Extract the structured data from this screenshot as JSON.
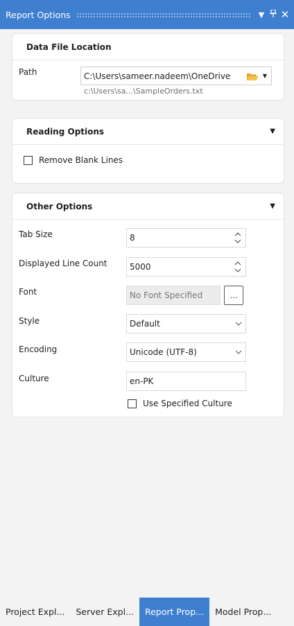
{
  "panel": {
    "title": "Report Options"
  },
  "data_file": {
    "header": "Data File Location",
    "path_label": "Path",
    "path_value": "C:\\Users\\sameer.nadeem\\OneDrive",
    "path_hint": "c:\\Users\\sa...\\SampleOrders.txt"
  },
  "reading": {
    "header": "Reading Options",
    "remove_blank_lines_label": "Remove Blank Lines",
    "remove_blank_lines_checked": false
  },
  "other": {
    "header": "Other Options",
    "tab_size_label": "Tab Size",
    "tab_size_value": "8",
    "line_count_label": "Displayed Line Count",
    "line_count_value": "5000",
    "font_label": "Font",
    "font_value": "No Font Specified",
    "font_button": "...",
    "style_label": "Style",
    "style_value": "Default",
    "encoding_label": "Encoding",
    "encoding_value": "Unicode (UTF-8)",
    "culture_label": "Culture",
    "culture_value": "en-PK",
    "use_specified_culture_label": "Use Specified Culture",
    "use_specified_culture_checked": false
  },
  "tabs": [
    "Project Expl...",
    "Server Expl...",
    "Report Prop...",
    "Model Prop..."
  ],
  "active_tab_index": 2,
  "colors": {
    "accent": "#3f7fcf",
    "folder": "#f0b93a"
  }
}
